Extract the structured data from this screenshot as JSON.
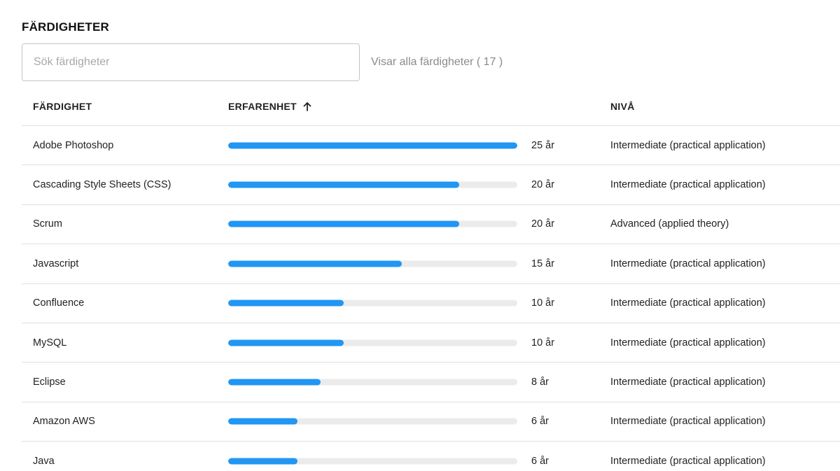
{
  "section": {
    "title": "FÄRDIGHETER"
  },
  "search": {
    "placeholder": "Sök färdigheter",
    "value": "",
    "count_text": "Visar alla färdigheter ( 17 )"
  },
  "table": {
    "headers": {
      "skill": "FÄRDIGHET",
      "experience": "ERFARENHET",
      "level": "NIVÅ"
    },
    "sort": {
      "column": "experience",
      "icon": "arrow-up-icon"
    },
    "max_years": 25,
    "rows": [
      {
        "skill": "Adobe Photoshop",
        "years": 25,
        "years_label": "25 år",
        "level": "Intermediate (practical application)"
      },
      {
        "skill": "Cascading Style Sheets (CSS)",
        "years": 20,
        "years_label": "20 år",
        "level": "Intermediate (practical application)"
      },
      {
        "skill": "Scrum",
        "years": 20,
        "years_label": "20 år",
        "level": "Advanced (applied theory)"
      },
      {
        "skill": "Javascript",
        "years": 15,
        "years_label": "15 år",
        "level": "Intermediate (practical application)"
      },
      {
        "skill": "Confluence",
        "years": 10,
        "years_label": "10 år",
        "level": "Intermediate (practical application)"
      },
      {
        "skill": "MySQL",
        "years": 10,
        "years_label": "10 år",
        "level": "Intermediate (practical application)"
      },
      {
        "skill": "Eclipse",
        "years": 8,
        "years_label": "8 år",
        "level": "Intermediate (practical application)"
      },
      {
        "skill": "Amazon AWS",
        "years": 6,
        "years_label": "6 år",
        "level": "Intermediate (practical application)"
      },
      {
        "skill": "Java",
        "years": 6,
        "years_label": "6 år",
        "level": "Intermediate (practical application)"
      }
    ]
  },
  "colors": {
    "bar_fill": "#2196f3",
    "bar_track": "#ebebeb"
  }
}
